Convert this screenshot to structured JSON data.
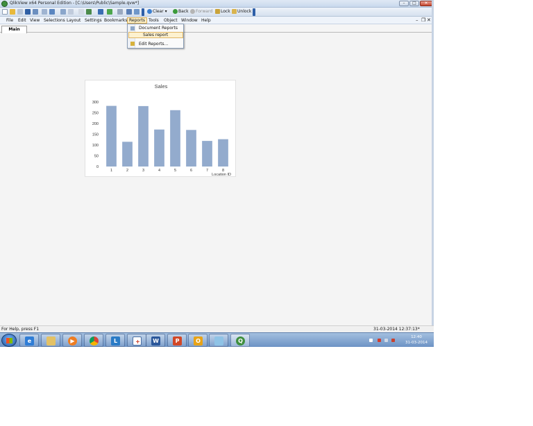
{
  "window": {
    "title": "QlikView x64 Personal Edition - [C:\\Users\\Public\\Sample.qvw*]",
    "controls": {
      "minimize": "–",
      "maximize": "□",
      "close": "✕"
    }
  },
  "toolbar": {
    "clear_label": "Clear",
    "back_label": "Back",
    "forward_label": "Forward",
    "lock_label": "Lock",
    "unlock_label": "Unlock"
  },
  "menubar": {
    "items": [
      "File",
      "Edit",
      "View",
      "Selections",
      "Layout",
      "Settings",
      "Bookmarks",
      "Reports",
      "Tools",
      "Object",
      "Window",
      "Help"
    ],
    "active": "Reports",
    "mdi_minimize": "–",
    "mdi_restore": "❐",
    "mdi_close": "✕"
  },
  "reports_menu": {
    "items": [
      {
        "label": "Document Reports"
      },
      {
        "label": "Sales report",
        "highlighted": true
      },
      {
        "label": "Edit Reports..."
      }
    ]
  },
  "tabs": {
    "active": "Main"
  },
  "chart_data": {
    "type": "bar",
    "title": "Sales",
    "xlabel": "Location ID",
    "ylabel": "",
    "categories": [
      "1",
      "2",
      "3",
      "4",
      "5",
      "6",
      "7",
      "8"
    ],
    "values": [
      282,
      115,
      281,
      172,
      262,
      170,
      119,
      127
    ],
    "yticks": [
      0,
      50,
      100,
      150,
      200,
      250,
      300
    ],
    "ylim": [
      0,
      300
    ],
    "bar_color": "#93abcd",
    "grid": false,
    "legend": "none"
  },
  "statusbar": {
    "help_text": "For Help, press F1",
    "timestamp": "31-03-2014 12:37:13*"
  },
  "taskbar": {
    "apps": [
      "internet-explorer",
      "file-explorer",
      "media-player",
      "chrome",
      "lync",
      "snipping-tool",
      "word",
      "powerpoint",
      "outlook",
      "notepad",
      "qlikview"
    ],
    "clock_time": "12:40",
    "clock_date": "31-03-2014"
  }
}
